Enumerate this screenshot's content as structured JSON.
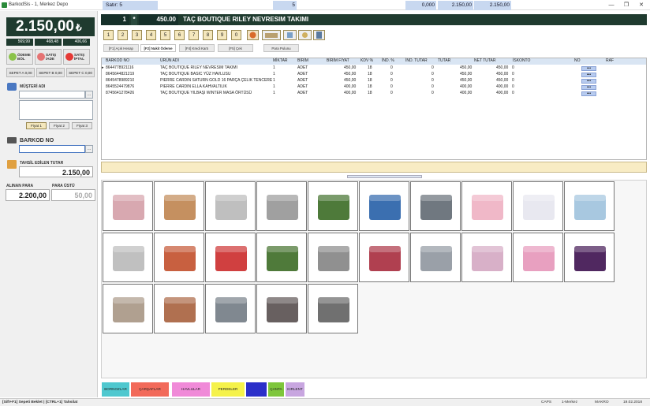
{
  "window": {
    "title": "BarkodSis - 1, Merkez Depo"
  },
  "left": {
    "total": "2.150,00",
    "currency_symbol": "₺",
    "mini_values": [
      "569,99",
      "468,48",
      "406,66"
    ],
    "buttons": {
      "odeme": "ÖDEME BÖL",
      "iade": "SATIŞ İADE",
      "iptal": "SATIŞ İPTAL"
    },
    "sepets": [
      "SEPET A 0,00",
      "SEPET B 0,00",
      "SEPET C 0,00"
    ],
    "musteri_label": "MÜŞTERİ ADI",
    "fiyat_buttons": [
      "Fiyat 1",
      "Fiyat 2",
      "Fiyat 3"
    ],
    "barkod_label": "BARKOD NO",
    "tahsil_label": "TAHSİL EDİLEN TUTAR",
    "tahsil_value": "2.150,00",
    "alinan_label": "ALINAN PARA",
    "alinan_value": "2.200,00",
    "paraustu_label": "PARA ÜSTÜ",
    "paraustu_value": "50,00"
  },
  "top": {
    "qty": "1",
    "mult": "*",
    "price": "450.00",
    "product_name": "TAÇ BOUTIQUE RILEY NEVRESIM TAKIMI",
    "numkeys": [
      "1",
      "2",
      "3",
      "4",
      "5",
      "6",
      "7",
      "8",
      "9",
      "0"
    ]
  },
  "tabs": [
    "[F1] Açık Hesap",
    "[F2] Nakit Ödeme",
    "[F4] Kredi Kartı",
    "[F5] Çek",
    "Para Pulunu"
  ],
  "grid": {
    "headers": [
      "BARKOD NO",
      "ÜRÜN ADI",
      "MİKTAR",
      "BİRİM",
      "BİRİM FİYAT",
      "KDV %",
      "İND. %",
      "İND. TUTAR",
      "TUTAR",
      "NET TUTAR",
      "İSKONTO",
      "NO",
      "RAF"
    ],
    "rows": [
      {
        "barkod": "8644778921116",
        "urun": "TAÇ BOUTIQUE RILEY NEVRESIM TAKIMI",
        "miktar": "1",
        "birim": "ADET",
        "fiyat": "450,00",
        "kdv": "18",
        "ind": "0",
        "indtutar": "0",
        "tutar": "450,00",
        "net": "450,00",
        "iskonto": "0"
      },
      {
        "barkod": "8645644821219",
        "urun": "TAÇ BOUTIQUE BASIC YÜZ HAVLUSU",
        "miktar": "1",
        "birim": "ADET",
        "fiyat": "450,00",
        "kdv": "18",
        "ind": "0",
        "indtutar": "0",
        "tutar": "450,00",
        "net": "450,00",
        "iskonto": "0"
      },
      {
        "barkod": "8645478989210",
        "urun": "PIERRE CARDIN SATURN GOLD 16 PARÇA ÇELIK TENCERE",
        "miktar": "1",
        "birim": "ADET",
        "fiyat": "450,00",
        "kdv": "18",
        "ind": "0",
        "indtutar": "0",
        "tutar": "450,00",
        "net": "450,00",
        "iskonto": "0"
      },
      {
        "barkod": "8645524479876",
        "urun": "PIERRE CARDIN ELLA KAHVALTILIK",
        "miktar": "1",
        "birim": "ADET",
        "fiyat": "400,00",
        "kdv": "18",
        "ind": "0",
        "indtutar": "0",
        "tutar": "400,00",
        "net": "400,00",
        "iskonto": "0"
      },
      {
        "barkod": "8745641278426",
        "urun": "TAÇ BOUTIQUE YILBAŞI WINTER MASA ÖRTÜSÜ",
        "miktar": "1",
        "birim": "ADET",
        "fiyat": "400,00",
        "kdv": "18",
        "ind": "0",
        "indtutar": "0",
        "tutar": "400,00",
        "net": "400,00",
        "iskonto": "0"
      }
    ],
    "dots": "•••"
  },
  "summary": {
    "satir": "Satır: 5",
    "miktar": "5",
    "indtutar": "0,000",
    "tutar": "2.150,00",
    "net": "2.150,00"
  },
  "products": [
    "pink towel",
    "beige towel",
    "grey towel",
    "cookware set",
    "oven mitt",
    "blue blanket",
    "grey blanket",
    "pink bathrobe",
    "white bathrobe",
    "blue bathrobe",
    "floral apron",
    "poncho",
    "pot holder",
    "green tablecloth",
    "checked tablecloth",
    "red plaid tablecloth",
    "grey bedding",
    "decor pillow",
    "pink pillow",
    "purple pillow",
    "bedroom set 1",
    "bedroom set 2",
    "grey bedding set",
    "floral bedding",
    "bedroom set 3"
  ],
  "categories": [
    {
      "label": "BORNOZLAR",
      "color": "#4fc8cf"
    },
    {
      "label": "ÇARŞAFLAR",
      "color": "#f26a5a"
    },
    {
      "label": "HAVLULAR",
      "color": "#f08ad8"
    },
    {
      "label": "PERDELER",
      "color": "#f5f24a"
    },
    {
      "label": "",
      "color": "#2b2fc9"
    },
    {
      "label": "ÇANTA",
      "color": "#7ec63c"
    },
    {
      "label": "KIRLENT",
      "color": "#c8a6e0"
    }
  ],
  "status": {
    "left": "[Sift+F1] Sepeti Beklet | [CTRL+1] Tahsilat",
    "caps": "CAPS",
    "store": "1-Merkez",
    "user": "MAKRO",
    "date": "19.02.2018"
  }
}
